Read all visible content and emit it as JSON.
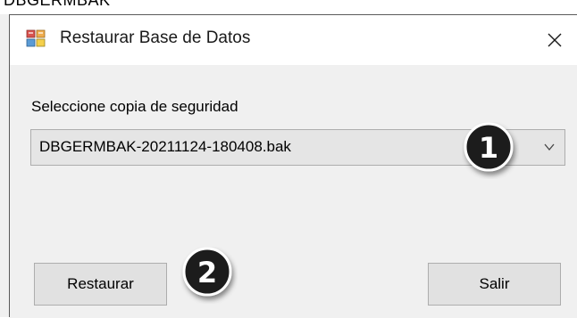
{
  "top_strip": {
    "text": "DBGERMBAK"
  },
  "window": {
    "title": "Restaurar Base de Datos",
    "close_glyph": "✕"
  },
  "form": {
    "backup_label": "Seleccione copia de seguridad",
    "backup_selected": "DBGERMBAK-20211124-180408.bak",
    "restore_button": "Restaurar",
    "exit_button": "Salir"
  },
  "markers": {
    "first": "1",
    "second": "2"
  },
  "icons": {
    "app": "database-restore-icon",
    "close": "close-icon",
    "dropdown": "chevron-down-icon"
  },
  "colors": {
    "window_bg": "#f0f0f0",
    "titlebar_bg": "#ffffff",
    "button_bg": "#e1e1e1",
    "combo_bg": "#e5e5e5",
    "marker_fill": "#1f1f1f"
  }
}
